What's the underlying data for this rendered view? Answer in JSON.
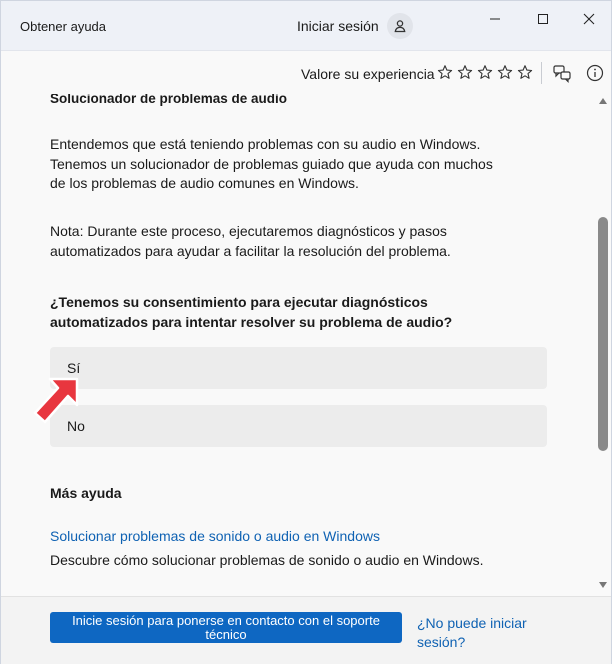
{
  "titlebar": {
    "app_title": "Obtener ayuda",
    "signin_label": "Iniciar sesión",
    "avatar_icon": "user-icon",
    "minimize_icon": "minimize-icon",
    "maximize_icon": "maximize-icon",
    "close_icon": "close-icon"
  },
  "rating": {
    "label": "Valore su experiencia",
    "stars_total": 5,
    "stars_filled": 0,
    "feedback_icon": "feedback-icon",
    "info_icon": "info-icon"
  },
  "content": {
    "section_title": "Solucionador de problemas de audio",
    "paragraph_1": "Entendemos que está teniendo problemas con su audio en Windows. Tenemos un solucionador de problemas guiado que ayuda con muchos de los problemas de audio comunes en Windows.",
    "paragraph_2": "Nota: Durante este proceso, ejecutaremos diagnósticos y pasos automatizados para ayudar a facilitar la resolución del problema.",
    "question": "¿Tenemos su consentimiento para ejecutar diagnósticos automatizados para intentar resolver su problema de audio?",
    "options": [
      {
        "label": "Sí"
      },
      {
        "label": "No"
      }
    ],
    "more_help_title": "Más ayuda",
    "help_link": "Solucionar problemas de sonido o audio en Windows",
    "help_desc": "Descubre cómo solucionar problemas de sonido o audio en Windows."
  },
  "footer": {
    "contact_button": "Inicie sesión para ponerse en contacto con el soporte técnico",
    "cant_signin_link": "¿No puede iniciar sesión?"
  },
  "colors": {
    "accent": "#0e67c2",
    "link": "#0f62b3",
    "annotation_arrow": "#e8363f"
  }
}
